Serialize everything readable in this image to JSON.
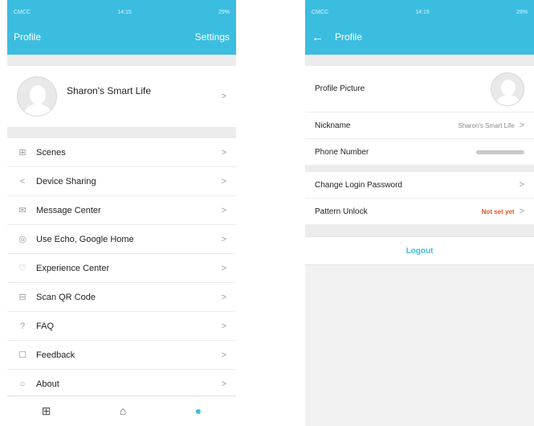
{
  "colors": {
    "accent": "#3bbde0",
    "warning": "#e8502a",
    "background": "#f2f2f2"
  },
  "left": {
    "status": {
      "carrier": "CMCC",
      "time": "14:15",
      "battery": "29%"
    },
    "header": {
      "title": "Profile",
      "settings": "Settings"
    },
    "profile": {
      "name": "Sharon's Smart Life"
    },
    "menu": [
      {
        "label": "Scenes",
        "icon": "grid-icon"
      },
      {
        "label": "Device Sharing",
        "icon": "share-icon"
      },
      {
        "label": "Message Center",
        "icon": "mail-icon"
      },
      {
        "label": "Use Echo, Google Home",
        "icon": "voice-icon"
      },
      {
        "label": "Experience Center",
        "icon": "heart-icon"
      },
      {
        "label": "Scan QR Code",
        "icon": "scan-icon"
      },
      {
        "label": "FAQ",
        "icon": "help-icon"
      },
      {
        "label": "Feedback",
        "icon": "feedback-icon"
      },
      {
        "label": "About",
        "icon": "info-icon"
      }
    ]
  },
  "right": {
    "status": {
      "carrier": "CMCC",
      "time": "14:15",
      "battery": "29%"
    },
    "header": {
      "title": "Profile"
    },
    "rows": {
      "picture": "Profile Picture",
      "nickname": "Nickname",
      "nickname_value": "Sharon's Smart Life",
      "phone": "Phone Number",
      "password": "Change Login Password",
      "pattern": "Pattern Unlock",
      "pattern_value": "Not set yet"
    },
    "logout": "Logout"
  }
}
